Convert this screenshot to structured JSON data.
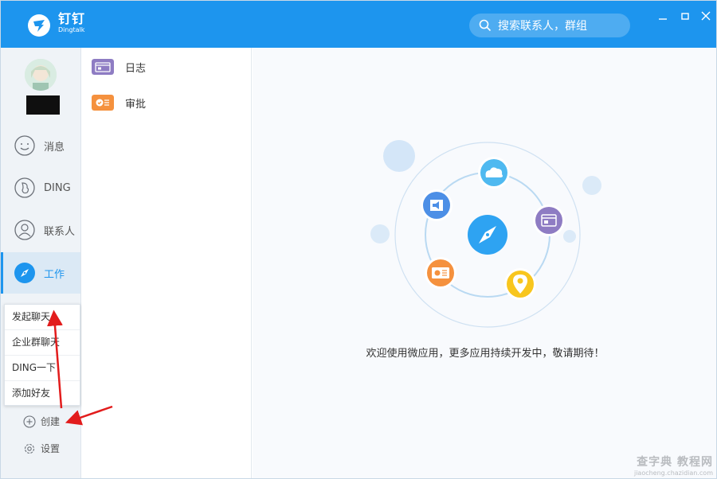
{
  "titlebar": {
    "brand_cn": "钉钉",
    "brand_en": "Dingtalk",
    "search_placeholder": "搜索联系人，群组",
    "accent": "#1d95ee"
  },
  "nav": {
    "items": [
      {
        "label": "消息",
        "icon": "smile-icon"
      },
      {
        "label": "DING",
        "icon": "ding-icon"
      },
      {
        "label": "联系人",
        "icon": "contact-icon"
      },
      {
        "label": "工作",
        "icon": "compass-icon",
        "active": true
      }
    ],
    "create_label": "创建",
    "settings_label": "设置"
  },
  "popup": {
    "items": [
      "发起聊天",
      "企业群聊天",
      "DING一下",
      "添加好友"
    ]
  },
  "apps": {
    "items": [
      {
        "label": "日志",
        "icon": "log-icon",
        "color": "#8e7cc3"
      },
      {
        "label": "审批",
        "icon": "approval-icon",
        "color": "#f5913e"
      }
    ]
  },
  "main": {
    "welcome": "欢迎使用微应用，更多应用持续开发中，敬请期待！",
    "watermark_line1": "查字典 教程网",
    "watermark_line2": "jiaocheng.chazidian.com"
  }
}
